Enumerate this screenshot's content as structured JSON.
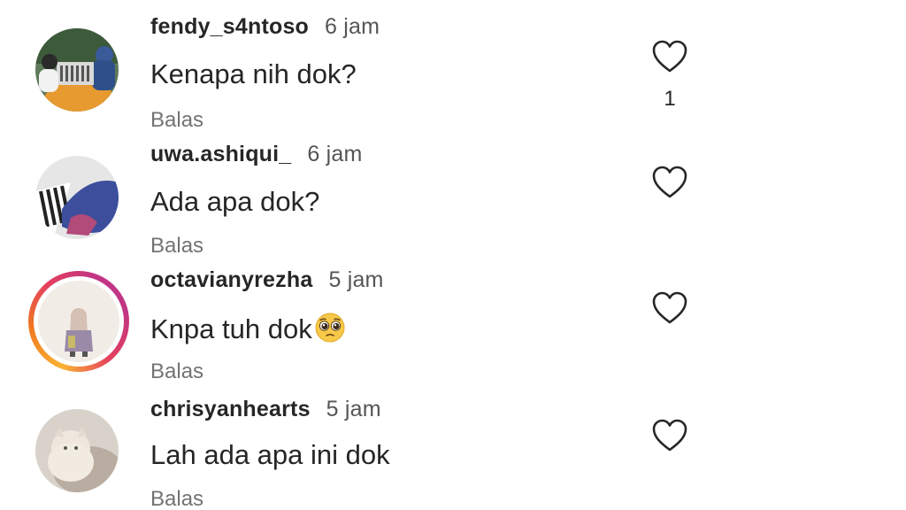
{
  "comments": [
    {
      "username": "fendy_s4ntoso",
      "time": "6 jam",
      "text": "Kenapa nih dok?",
      "reply_label": "Balas",
      "likes": "1",
      "avatar_icon": "profile-photo"
    },
    {
      "username": "uwa.ashiqui_",
      "time": "6 jam",
      "text": "Ada apa dok?",
      "reply_label": "Balas",
      "likes": "",
      "avatar_icon": "profile-photo"
    },
    {
      "username": "octavianyrezha",
      "time": "5 jam",
      "text": "Knpa tuh dok",
      "emoji": "pleading-face-emoji",
      "reply_label": "Balas",
      "likes": "",
      "avatar_icon": "profile-photo-with-story-ring"
    },
    {
      "username": "chrisyanhearts",
      "time": "5 jam",
      "text": "Lah ada apa ini dok",
      "reply_label": "Balas",
      "likes": "",
      "avatar_icon": "profile-photo"
    }
  ],
  "icons": {
    "like": "heart-outline-icon"
  },
  "colors": {
    "text": "#262626",
    "secondary": "#737373",
    "story_ring": [
      "#f9b233",
      "#e4405f",
      "#c13584"
    ]
  }
}
